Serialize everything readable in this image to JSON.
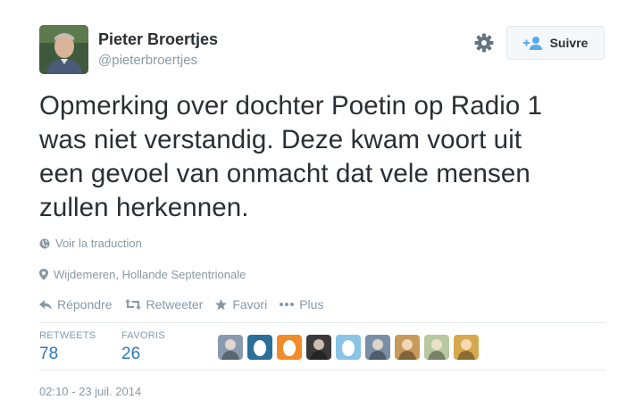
{
  "author": {
    "name": "Pieter Broertjes",
    "handle": "@pieterbroertjes"
  },
  "follow_button": {
    "label": "Suivre"
  },
  "tweet": {
    "lines": [
      "Opmerking over dochter Poetin op Radio 1",
      "was niet verstandig. Deze kwam voort uit",
      "een gevoel van onmacht dat vele mensen",
      "zullen herkennen."
    ]
  },
  "translate_link": "Voir la traduction",
  "location": "Wijdemeren, Hollande Septentrionale",
  "actions": {
    "reply": "Répondre",
    "retweet": "Retweeter",
    "favorite": "Favori",
    "more": "Plus"
  },
  "stats": {
    "retweets_label": "RETWEETS",
    "retweets_count": "78",
    "favorites_label": "FAVORIS",
    "favorites_count": "26"
  },
  "engagers": [
    {
      "kind": "photo",
      "color": "#8a9bb0"
    },
    {
      "kind": "egg",
      "color": "#2a6f97"
    },
    {
      "kind": "egg",
      "color": "#f28c28"
    },
    {
      "kind": "photo",
      "color": "#3a3a3a"
    },
    {
      "kind": "egg",
      "color": "#89c4e8"
    },
    {
      "kind": "photo",
      "color": "#7a8fa6"
    },
    {
      "kind": "photo",
      "color": "#c79a5c"
    },
    {
      "kind": "photo",
      "color": "#b8c8a0"
    },
    {
      "kind": "photo",
      "color": "#d6a84e"
    }
  ],
  "timestamp": "02:10 - 23 juil. 2014",
  "colors": {
    "accent": "#2b7bb9",
    "muted": "#8899a6",
    "text": "#292f33"
  },
  "icons": [
    "gear-icon",
    "add-user-icon",
    "globe-icon",
    "location-pin-icon",
    "reply-icon",
    "retweet-icon",
    "star-icon",
    "more-icon"
  ]
}
